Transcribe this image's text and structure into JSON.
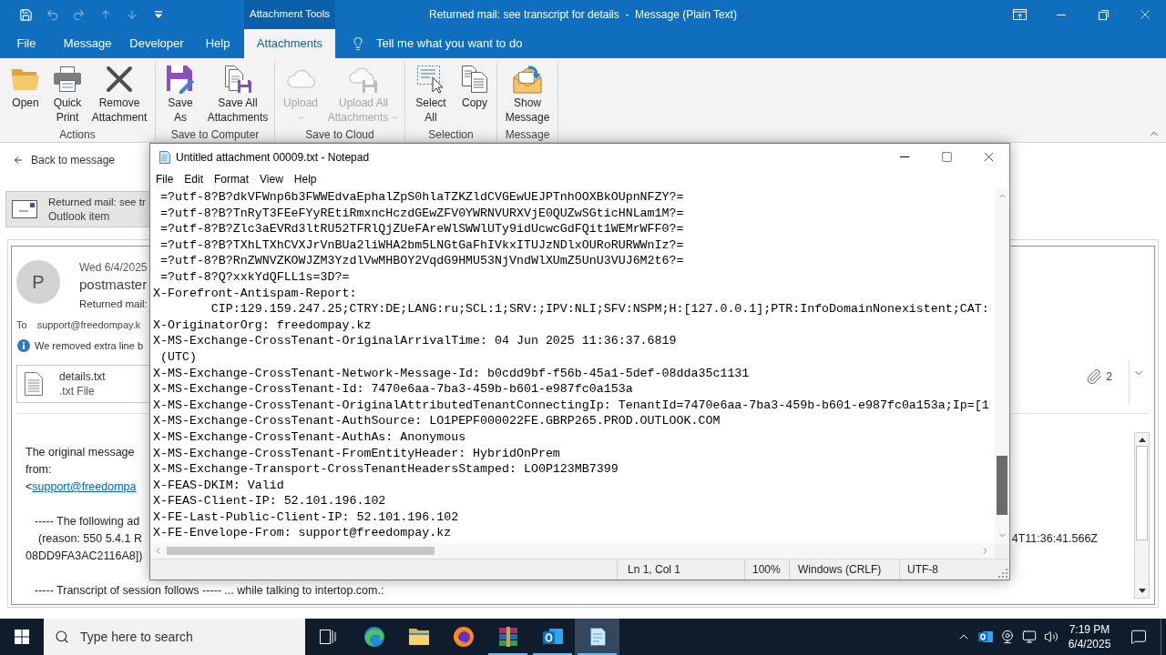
{
  "outlook": {
    "quick_access": [
      {
        "kind": "save",
        "disabled": false
      },
      {
        "kind": "undo",
        "disabled": true
      },
      {
        "kind": "redo",
        "disabled": true
      },
      {
        "kind": "previous",
        "disabled": true
      },
      {
        "kind": "next",
        "disabled": true
      },
      {
        "kind": "customize",
        "disabled": false
      }
    ],
    "context_tab_group": "Attachment Tools",
    "title": "Returned mail: see transcript for details  -  Message (Plain Text)",
    "tabs": [
      {
        "label": "File",
        "selected": false
      },
      {
        "label": "Message",
        "selected": false
      },
      {
        "label": "Developer",
        "selected": false
      },
      {
        "label": "Help",
        "selected": false
      },
      {
        "label": "Attachments",
        "selected": true
      }
    ],
    "tell_me": "Tell me what you want to do",
    "ribbon": [
      {
        "label": "Actions",
        "buttons": [
          {
            "kind": "open",
            "lines": [
              "Open"
            ],
            "disabled": false,
            "dropdown": false
          },
          {
            "kind": "quick_print",
            "lines": [
              "Quick",
              "Print"
            ],
            "disabled": false,
            "dropdown": false
          },
          {
            "kind": "remove_attachment",
            "lines": [
              "Remove",
              "Attachment"
            ],
            "disabled": false,
            "dropdown": false
          }
        ]
      },
      {
        "label": "Save to Computer",
        "buttons": [
          {
            "kind": "save_as",
            "lines": [
              "Save",
              "As"
            ],
            "disabled": false,
            "dropdown": false
          },
          {
            "kind": "save_all",
            "lines": [
              "Save All",
              "Attachments"
            ],
            "disabled": false,
            "dropdown": false
          }
        ]
      },
      {
        "label": "Save to Cloud",
        "buttons": [
          {
            "kind": "upload",
            "lines": [
              "Upload"
            ],
            "disabled": true,
            "dropdown": true
          },
          {
            "kind": "upload_all",
            "lines": [
              "Upload All",
              "Attachments"
            ],
            "disabled": true,
            "dropdown": true
          }
        ]
      },
      {
        "label": "Selection",
        "buttons": [
          {
            "kind": "select_all",
            "lines": [
              "Select",
              "All"
            ],
            "disabled": false,
            "dropdown": false
          },
          {
            "kind": "copy",
            "lines": [
              "Copy"
            ],
            "disabled": false,
            "dropdown": false
          }
        ]
      },
      {
        "label": "Message",
        "buttons": [
          {
            "kind": "show_message",
            "lines": [
              "Show",
              "Message"
            ],
            "disabled": false,
            "dropdown": false
          }
        ]
      }
    ]
  },
  "message_window": {
    "back_link": "Back to message",
    "item_bar": {
      "title": "Returned mail: see tr",
      "subtitle": "Outlook item"
    },
    "header": {
      "avatar": "P",
      "date": "Wed 6/4/2025",
      "sender": "postmaster",
      "subject": "Returned mail:",
      "to_label": "To",
      "to": "support@freedompay.k",
      "notice": "We removed extra line b",
      "attachment": {
        "name": "details.txt",
        "type": ".txt File"
      },
      "attachment_count": "2"
    },
    "body": [
      [
        {
          "kind": "text",
          "text": "The original message"
        },
        {
          "kind": "text",
          "text": "from:"
        },
        {
          "kind": "link",
          "prefix": "<",
          "text": "support@freedompa"
        }
      ],
      [
        {
          "kind": "indented",
          "text": "----- The following ad"
        },
        {
          "kind": "split",
          "text": "(reason: 550 5.4.1 R",
          "right": "4T11:36:41.566Z"
        },
        {
          "kind": "text",
          "text": "08DD9FA3AC2116A8])"
        }
      ],
      [
        {
          "kind": "indented",
          "text": "----- Transcript of session follows ----- ... while talking to intertop.com.:"
        }
      ]
    ]
  },
  "notepad": {
    "title": "Untitled attachment 00009.txt - Notepad",
    "menu": [
      "File",
      "Edit",
      "Format",
      "View",
      "Help"
    ],
    "lines": [
      " =?utf-8?B?dkVFWnp6b3FWWEdvaEphalZpS0hlaTZKZldCVGEwUEJPTnhOOXBkOUpnNFZY?=",
      " =?utf-8?B?TnRyT3FEeFYyREtiRmxncHczdGEwZFV0YWRNVURXVjE0QUZwSGticHNLam1M?=",
      " =?utf-8?B?Zlc3aEVRd3ltRU52TFRlQjZUeFAreWlSWWlUTy9idUcwcGdFQit1WEMrWFF0?=",
      " =?utf-8?B?TXhLTXhCVXJrVnBUa2liWHA2bm5LNGtGaFhIVkxITUJzNDlxOURoRURWWnIz?=",
      " =?utf-8?B?RnZWNVZKOWJZM3YzdlVwMHBOY2VqdG9HMU53NjVndWlXUmZ5UnU3VUJ6M2t6?=",
      " =?utf-8?Q?xxkYdQFLL1s=3D?=",
      "X-Forefront-Antispam-Report:",
      "        CIP:129.159.247.25;CTRY:DE;LANG:ru;SCL:1;SRV:;IPV:NLI;SFV:NSPM;H:[127.0.0.1];PTR:InfoDomainNonexistent;CAT:",
      "X-OriginatorOrg: freedompay.kz",
      "X-MS-Exchange-CrossTenant-OriginalArrivalTime: 04 Jun 2025 11:36:37.6819",
      " (UTC)",
      "X-MS-Exchange-CrossTenant-Network-Message-Id: b0cdd9bf-f56b-45a1-5def-08dda35c1131",
      "X-MS-Exchange-CrossTenant-Id: 7470e6aa-7ba3-459b-b601-e987fc0a153a",
      "X-MS-Exchange-CrossTenant-OriginalAttributedTenantConnectingIp: TenantId=7470e6aa-7ba3-459b-b601-e987fc0a153a;Ip=[1",
      "X-MS-Exchange-CrossTenant-AuthSource: LO1PEPF000022FE.GBRP265.PROD.OUTLOOK.COM",
      "X-MS-Exchange-CrossTenant-AuthAs: Anonymous",
      "X-MS-Exchange-CrossTenant-FromEntityHeader: HybridOnPrem",
      "X-MS-Exchange-Transport-CrossTenantHeadersStamped: LO0P123MB7399",
      "X-FEAS-DKIM: Valid",
      "X-FEAS-Client-IP: 52.101.196.102",
      "X-FE-Last-Public-Client-IP: 52.101.196.102",
      "X-FE-Envelope-From: support@freedompay.kz"
    ],
    "status": {
      "position": "Ln 1, Col 1",
      "zoom": "100%",
      "line_ending": "Windows (CRLF)",
      "encoding": "UTF-8"
    }
  },
  "taskbar": {
    "search": {
      "placeholder": "Type here to search"
    },
    "apps": [
      {
        "kind": "edge",
        "running": false,
        "selected": false
      },
      {
        "kind": "explorer",
        "running": false,
        "selected": false
      },
      {
        "kind": "firefox",
        "running": false,
        "selected": false
      },
      {
        "kind": "winrar",
        "running": true,
        "selected": false
      },
      {
        "kind": "outlook",
        "running": true,
        "selected": false
      },
      {
        "kind": "notepad",
        "running": true,
        "selected": true
      }
    ],
    "time": "7:19 PM",
    "date": "6/4/2025"
  }
}
